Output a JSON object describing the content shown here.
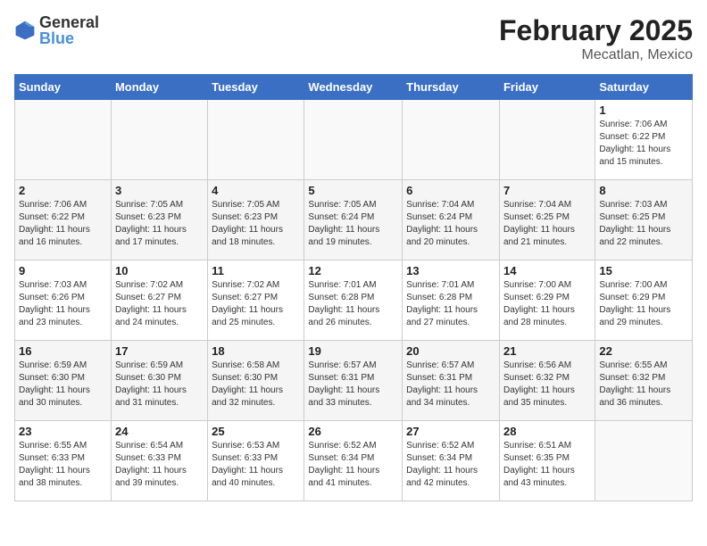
{
  "logo": {
    "line1": "General",
    "line2": "Blue"
  },
  "title": "February 2025",
  "subtitle": "Mecatlan, Mexico",
  "days_header": [
    "Sunday",
    "Monday",
    "Tuesday",
    "Wednesday",
    "Thursday",
    "Friday",
    "Saturday"
  ],
  "weeks": [
    [
      {
        "num": "",
        "info": ""
      },
      {
        "num": "",
        "info": ""
      },
      {
        "num": "",
        "info": ""
      },
      {
        "num": "",
        "info": ""
      },
      {
        "num": "",
        "info": ""
      },
      {
        "num": "",
        "info": ""
      },
      {
        "num": "1",
        "info": "Sunrise: 7:06 AM\nSunset: 6:22 PM\nDaylight: 11 hours\nand 15 minutes."
      }
    ],
    [
      {
        "num": "2",
        "info": "Sunrise: 7:06 AM\nSunset: 6:22 PM\nDaylight: 11 hours\nand 16 minutes."
      },
      {
        "num": "3",
        "info": "Sunrise: 7:05 AM\nSunset: 6:23 PM\nDaylight: 11 hours\nand 17 minutes."
      },
      {
        "num": "4",
        "info": "Sunrise: 7:05 AM\nSunset: 6:23 PM\nDaylight: 11 hours\nand 18 minutes."
      },
      {
        "num": "5",
        "info": "Sunrise: 7:05 AM\nSunset: 6:24 PM\nDaylight: 11 hours\nand 19 minutes."
      },
      {
        "num": "6",
        "info": "Sunrise: 7:04 AM\nSunset: 6:24 PM\nDaylight: 11 hours\nand 20 minutes."
      },
      {
        "num": "7",
        "info": "Sunrise: 7:04 AM\nSunset: 6:25 PM\nDaylight: 11 hours\nand 21 minutes."
      },
      {
        "num": "8",
        "info": "Sunrise: 7:03 AM\nSunset: 6:25 PM\nDaylight: 11 hours\nand 22 minutes."
      }
    ],
    [
      {
        "num": "9",
        "info": "Sunrise: 7:03 AM\nSunset: 6:26 PM\nDaylight: 11 hours\nand 23 minutes."
      },
      {
        "num": "10",
        "info": "Sunrise: 7:02 AM\nSunset: 6:27 PM\nDaylight: 11 hours\nand 24 minutes."
      },
      {
        "num": "11",
        "info": "Sunrise: 7:02 AM\nSunset: 6:27 PM\nDaylight: 11 hours\nand 25 minutes."
      },
      {
        "num": "12",
        "info": "Sunrise: 7:01 AM\nSunset: 6:28 PM\nDaylight: 11 hours\nand 26 minutes."
      },
      {
        "num": "13",
        "info": "Sunrise: 7:01 AM\nSunset: 6:28 PM\nDaylight: 11 hours\nand 27 minutes."
      },
      {
        "num": "14",
        "info": "Sunrise: 7:00 AM\nSunset: 6:29 PM\nDaylight: 11 hours\nand 28 minutes."
      },
      {
        "num": "15",
        "info": "Sunrise: 7:00 AM\nSunset: 6:29 PM\nDaylight: 11 hours\nand 29 minutes."
      }
    ],
    [
      {
        "num": "16",
        "info": "Sunrise: 6:59 AM\nSunset: 6:30 PM\nDaylight: 11 hours\nand 30 minutes."
      },
      {
        "num": "17",
        "info": "Sunrise: 6:59 AM\nSunset: 6:30 PM\nDaylight: 11 hours\nand 31 minutes."
      },
      {
        "num": "18",
        "info": "Sunrise: 6:58 AM\nSunset: 6:30 PM\nDaylight: 11 hours\nand 32 minutes."
      },
      {
        "num": "19",
        "info": "Sunrise: 6:57 AM\nSunset: 6:31 PM\nDaylight: 11 hours\nand 33 minutes."
      },
      {
        "num": "20",
        "info": "Sunrise: 6:57 AM\nSunset: 6:31 PM\nDaylight: 11 hours\nand 34 minutes."
      },
      {
        "num": "21",
        "info": "Sunrise: 6:56 AM\nSunset: 6:32 PM\nDaylight: 11 hours\nand 35 minutes."
      },
      {
        "num": "22",
        "info": "Sunrise: 6:55 AM\nSunset: 6:32 PM\nDaylight: 11 hours\nand 36 minutes."
      }
    ],
    [
      {
        "num": "23",
        "info": "Sunrise: 6:55 AM\nSunset: 6:33 PM\nDaylight: 11 hours\nand 38 minutes."
      },
      {
        "num": "24",
        "info": "Sunrise: 6:54 AM\nSunset: 6:33 PM\nDaylight: 11 hours\nand 39 minutes."
      },
      {
        "num": "25",
        "info": "Sunrise: 6:53 AM\nSunset: 6:33 PM\nDaylight: 11 hours\nand 40 minutes."
      },
      {
        "num": "26",
        "info": "Sunrise: 6:52 AM\nSunset: 6:34 PM\nDaylight: 11 hours\nand 41 minutes."
      },
      {
        "num": "27",
        "info": "Sunrise: 6:52 AM\nSunset: 6:34 PM\nDaylight: 11 hours\nand 42 minutes."
      },
      {
        "num": "28",
        "info": "Sunrise: 6:51 AM\nSunset: 6:35 PM\nDaylight: 11 hours\nand 43 minutes."
      },
      {
        "num": "",
        "info": ""
      }
    ]
  ]
}
